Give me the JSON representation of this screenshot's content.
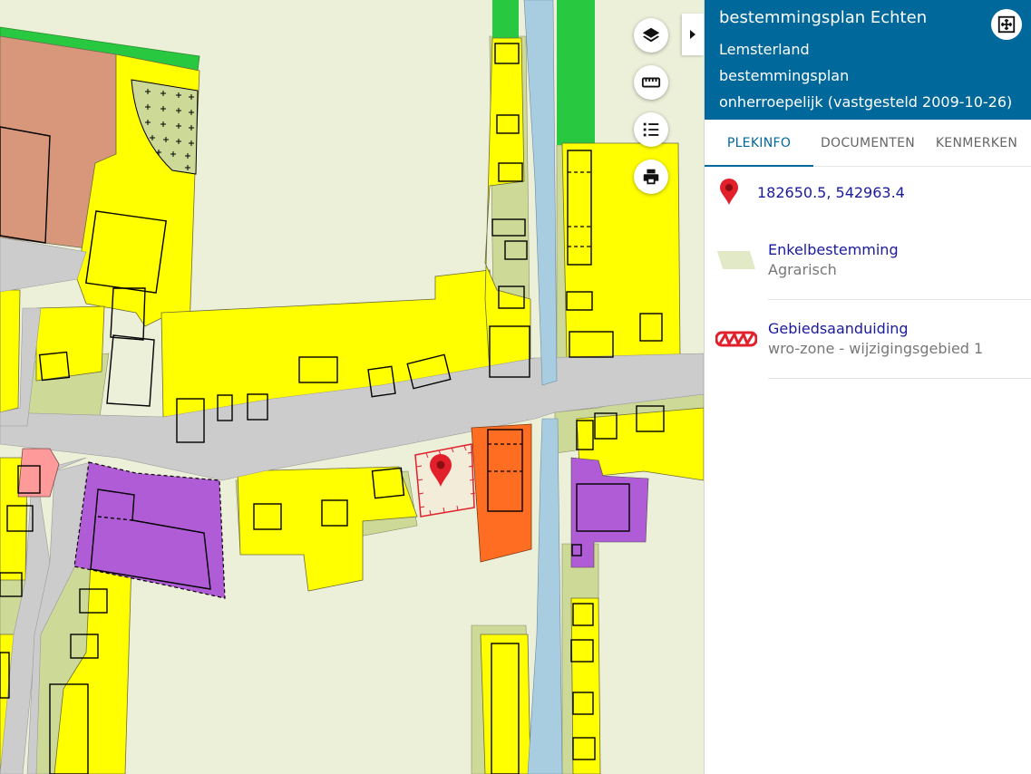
{
  "map": {
    "controls": [
      "layers-icon",
      "ruler-icon",
      "legend-list-icon",
      "print-icon"
    ]
  },
  "panel": {
    "title": "bestemmingsplan Echten",
    "municipality": "Lemsterland",
    "plan_type": "bestemmingsplan",
    "status": "onherroepelijk (vastgesteld 2009-10-26)",
    "tabs": [
      {
        "label": "PLEKINFO",
        "active": true
      },
      {
        "label": "DOCUMENTEN",
        "active": false
      },
      {
        "label": "KENMERKEN",
        "active": false
      }
    ],
    "coordinates": "182650.5, 542963.4",
    "items": [
      {
        "title": "Enkelbestemming",
        "subtitle": "Agrarisch",
        "symbol": "agrarisch-swatch"
      },
      {
        "title": "Gebiedsaanduiding",
        "subtitle": "wro-zone - wijzigingsgebied 1",
        "symbol": "wro-zone-swatch"
      }
    ]
  },
  "colors": {
    "header": "#01689b",
    "agrarisch": "#ecf0d9",
    "wonen": "#ffff00",
    "tuin": "#cdda97",
    "road": "#cccccc",
    "water": "#a8cde0",
    "groen": "#28c940",
    "maatschappelijk": "#b05cd6",
    "bedrijf": "#ff6d23",
    "kantoor": "#d8977a",
    "marker": "#e2202c"
  }
}
